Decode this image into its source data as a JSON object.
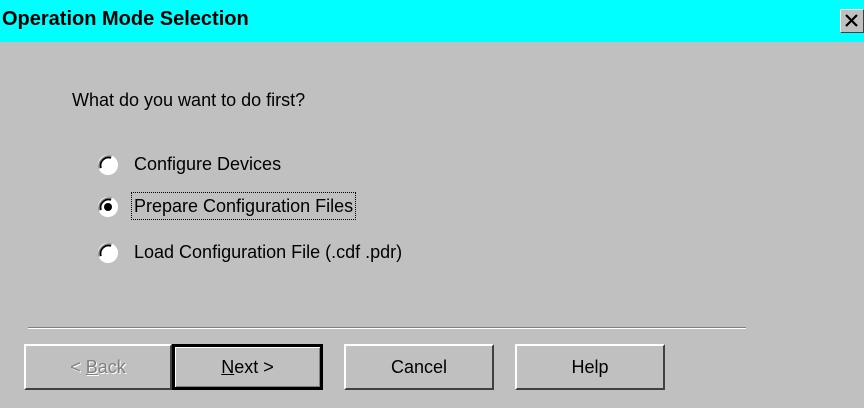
{
  "window": {
    "title": "Operation Mode Selection",
    "close_symbol": "×",
    "title_bg_color": "#00ffff"
  },
  "question": "What do you want to do first?",
  "options": [
    {
      "label": "Configure Devices",
      "selected": false
    },
    {
      "label": "Prepare Configuration Files",
      "selected": true
    },
    {
      "label": "Load Configuration File (.cdf .pdr)",
      "selected": false
    }
  ],
  "buttons": {
    "back": {
      "prefix": "< ",
      "mnemonic": "B",
      "rest": "ack",
      "enabled": false
    },
    "next": {
      "mnemonic": "N",
      "rest": "ext >",
      "default": true
    },
    "cancel": {
      "label": "Cancel"
    },
    "help": {
      "label": "Help"
    }
  }
}
